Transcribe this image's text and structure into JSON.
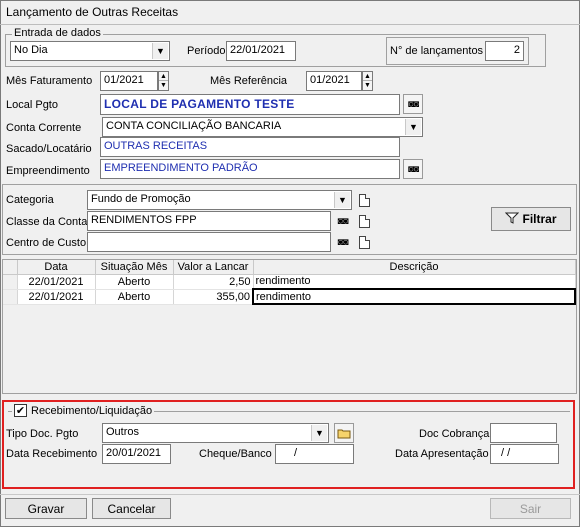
{
  "window": {
    "title": "Lançamento de Outras Receitas"
  },
  "entrada": {
    "legend": "Entrada de dados",
    "tipo_value": "No Dia",
    "periodo_label": "Período",
    "periodo_value": "22/01/2021",
    "num_lanc_label": "N° de lançamentos",
    "num_lanc_value": "2"
  },
  "form": {
    "mes_fat_label": "Mês Faturamento",
    "mes_fat_value": "01/2021",
    "mes_ref_label": "Mês Referência",
    "mes_ref_value": "01/2021",
    "local_label": "Local Pgto",
    "local_value": "LOCAL DE PAGAMENTO TESTE",
    "conta_label": "Conta Corrente",
    "conta_value": "CONTA CONCILIAÇÃO BANCARIA",
    "sacado_label": "Sacado/Locatário",
    "sacado_value": "OUTRAS RECEITAS",
    "empreend_label": "Empreendimento",
    "empreend_value": "EMPREENDIMENTO PADRÃO"
  },
  "filtro": {
    "categoria_label": "Categoria",
    "categoria_value": "Fundo de Promoção",
    "classe_label": "Classe da Conta",
    "classe_value": "RENDIMENTOS FPP",
    "centro_label": "Centro de Custo",
    "centro_value": "",
    "filtrar_label": "Filtrar"
  },
  "grid": {
    "columns": [
      "Data",
      "Situação Mês",
      "Valor a Lancar",
      "Descrição"
    ],
    "rows": [
      {
        "data": "22/01/2021",
        "situacao": "Aberto",
        "valor": "2,50",
        "descricao": "rendimento"
      },
      {
        "data": "22/01/2021",
        "situacao": "Aberto",
        "valor": "355,00",
        "descricao": "rendimento"
      }
    ]
  },
  "recebimento": {
    "legend": "Recebimento/Liquidação",
    "checked": true,
    "tipo_doc_label": "Tipo Doc. Pgto",
    "tipo_doc_value": "Outros",
    "doc_cobranca_label": "Doc Cobrança",
    "doc_cobranca_value": "",
    "data_receb_label": "Data Recebimento",
    "data_receb_value": "20/01/2021",
    "cheque_label": "Cheque/Banco",
    "cheque_value": "/",
    "data_apres_label": "Data Apresentação",
    "data_apres_value": "/  /",
    "highlight_color": "#e02020"
  },
  "footer": {
    "gravar_label": "Gravar",
    "cancelar_label": "Cancelar",
    "sair_label": "Sair"
  },
  "colors": {
    "accent_text": "#1f2fb0",
    "window_bg": "#f0f0f0"
  }
}
